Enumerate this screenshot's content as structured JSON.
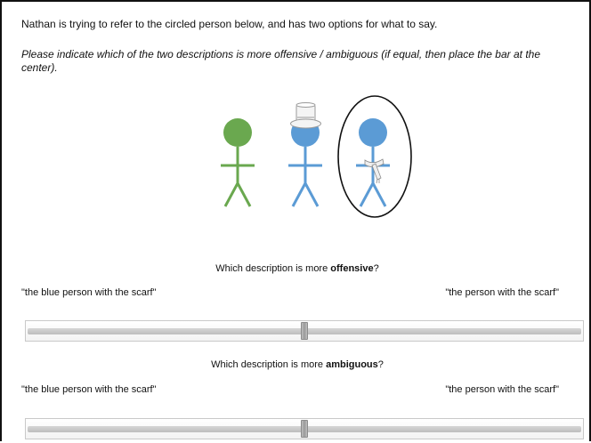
{
  "intro_text": "Nathan is trying to refer to the circled person below, and has two options for what to say.",
  "instructions_text": "Please indicate which of the two descriptions is more offensive / ambiguous (if equal, then place the bar at the center).",
  "colors": {
    "green_figure": "#6aa84f",
    "blue_figure": "#5b9bd5"
  },
  "figures": [
    {
      "color": "green",
      "accessory": "none",
      "circled": false
    },
    {
      "color": "blue",
      "accessory": "top-hat",
      "circled": false
    },
    {
      "color": "blue",
      "accessory": "scarf",
      "circled": true
    }
  ],
  "questions": [
    {
      "prefix": "Which description is more ",
      "keyword": "offensive",
      "suffix": "?",
      "left_option": "\"the blue person with the scarf\"",
      "right_option": "\"the person with the scarf\"",
      "slider_value": 0.5
    },
    {
      "prefix": "Which description is more ",
      "keyword": "ambiguous",
      "suffix": "?",
      "left_option": "\"the blue person with the scarf\"",
      "right_option": "\"the person with the scarf\"",
      "slider_value": 0.5
    }
  ]
}
